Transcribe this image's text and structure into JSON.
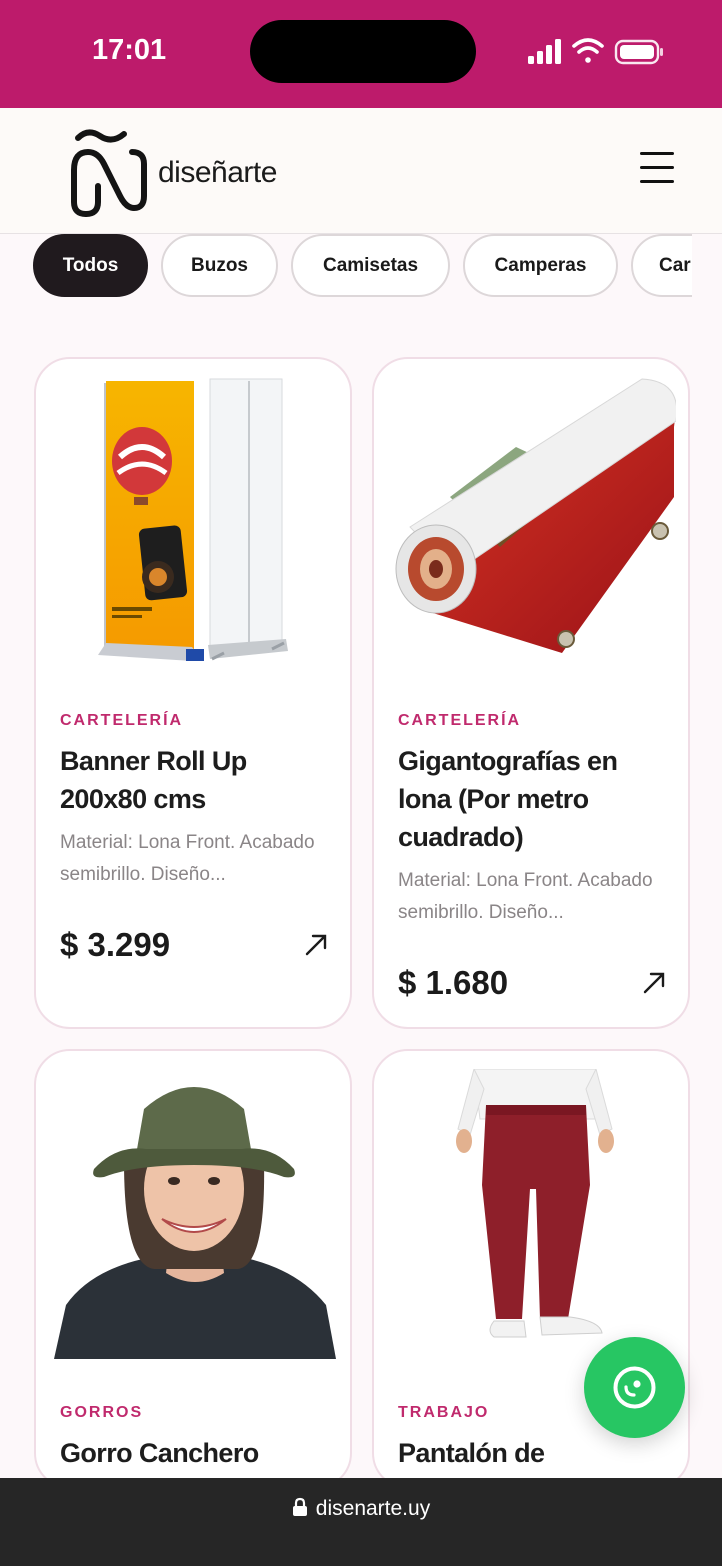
{
  "status": {
    "time": "17:01"
  },
  "header": {
    "logo_text": "diseñarte"
  },
  "filters": [
    "Todos",
    "Buzos",
    "Camisetas",
    "Camperas",
    "Car"
  ],
  "products": [
    {
      "category": "CARTELERÍA",
      "title": "Banner Roll Up 200x80 cms",
      "description": "Material: Lona Front. Acabado semibrillo. Diseño...",
      "price": "$ 3.299",
      "image_icon": "roll-up-banner-image"
    },
    {
      "category": "CARTELERÍA",
      "title": "Gigantografías en lona (Por metro cuadrado)",
      "description": "Material: Lona Front. Acabado semibrillo. Diseño...",
      "price": "$ 1.680",
      "image_icon": "vinyl-roll-image"
    },
    {
      "category": "GORROS",
      "title": "Gorro Canchero",
      "image_icon": "bucket-hat-photo"
    },
    {
      "category": "TRABAJO",
      "title": "Pantalón de",
      "image_icon": "work-pants-photo"
    }
  ],
  "browser": {
    "url": "disenarte.uy"
  },
  "colors": {
    "brand": "#bd1b6b",
    "category": "#c02a6d",
    "whatsapp": "#27c663",
    "chip_active": "#201a1e"
  }
}
